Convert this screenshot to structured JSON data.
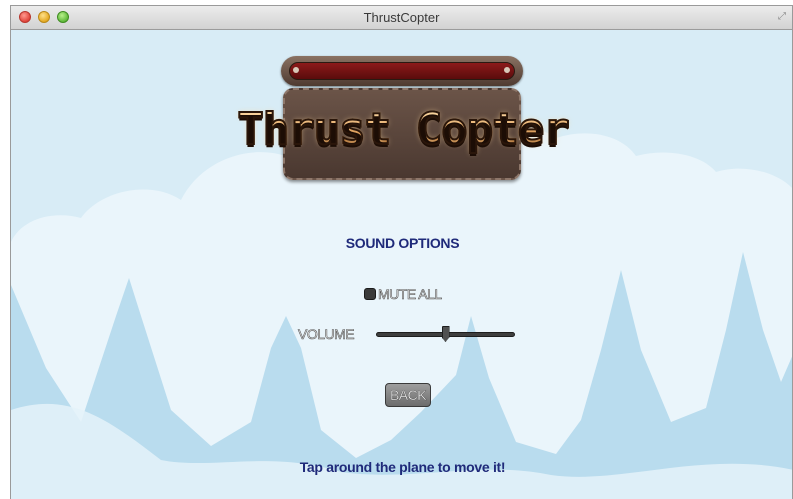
{
  "window": {
    "title": "ThrustCopter",
    "controls": [
      "close",
      "minimize",
      "zoom"
    ],
    "resize_icon": "fullscreen-arrows-icon"
  },
  "game": {
    "logo_text": "Thrust Copter",
    "sound_options": {
      "title": "SOUND OPTIONS",
      "mute_all": {
        "label": "MUTE ALL",
        "checked": false
      },
      "volume": {
        "label": "VOLUME",
        "value": 0.5
      }
    },
    "back_label": "BACK",
    "hint": "Tap around the plane to move it!"
  },
  "colors": {
    "sky": "#d8ecf6",
    "cloud": "#eaf5fb",
    "mountain": "#b9dcee",
    "menu_text": "#1f2a7a",
    "logo_wood": "#5b4538",
    "logo_red": "#7a1414"
  }
}
